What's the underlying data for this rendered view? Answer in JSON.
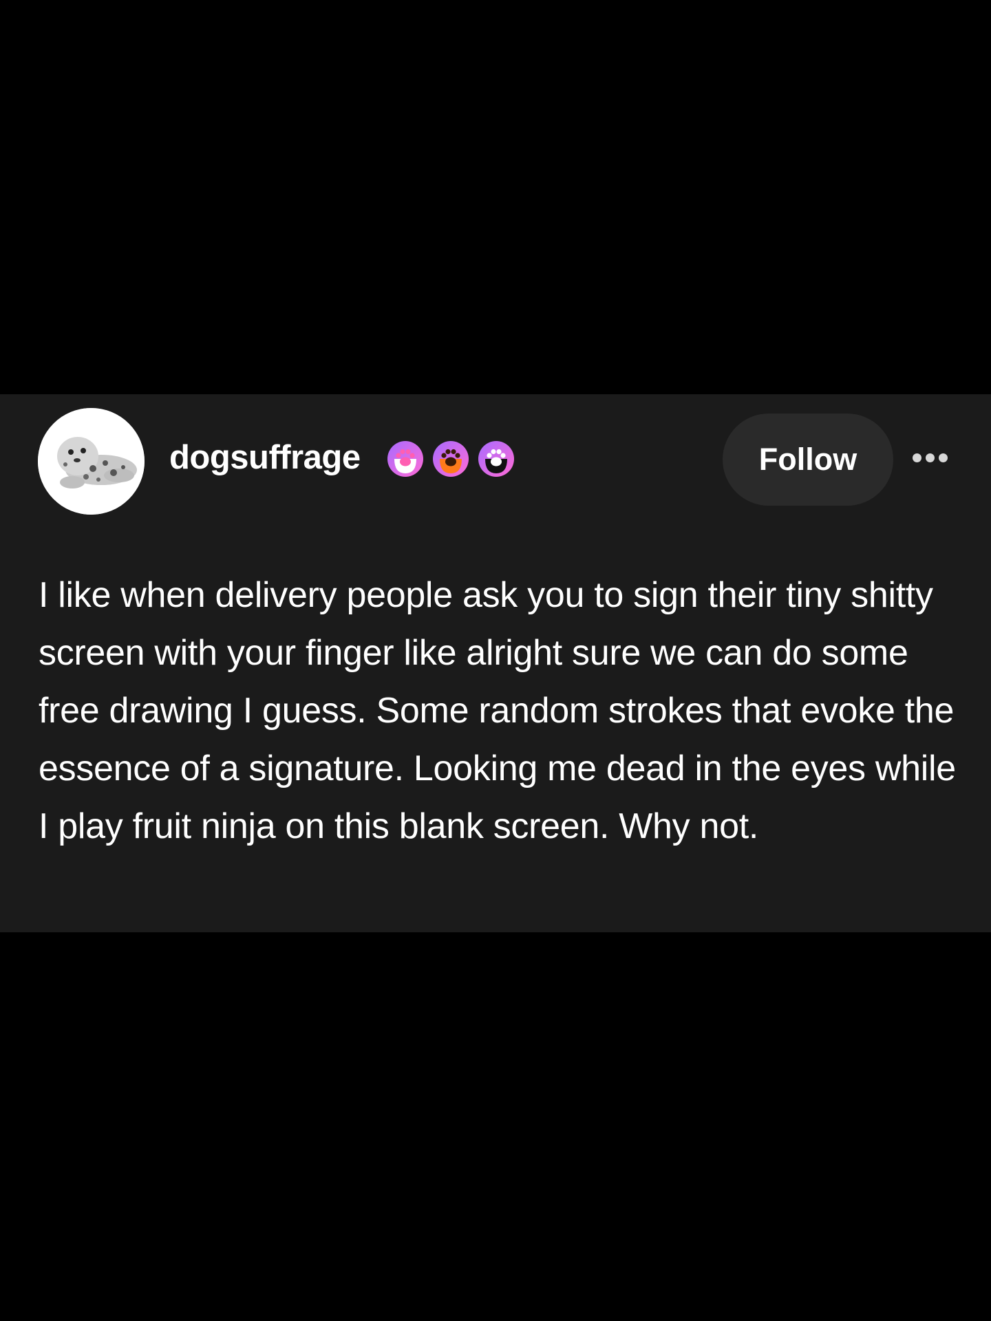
{
  "post": {
    "author": {
      "username": "dogsuffrage",
      "avatar_icon": "plush-seal-avatar",
      "badges": [
        {
          "icon": "paw-badge-icon",
          "paw_color": "#ff5fb2",
          "body_color": "#ffffff"
        },
        {
          "icon": "paw-badge-icon",
          "paw_color": "#3a1a08",
          "body_color": "#ff7a1a"
        },
        {
          "icon": "paw-badge-icon",
          "paw_color": "#ffffff",
          "body_color": "#111111"
        }
      ]
    },
    "follow_label": "Follow",
    "more_icon": "ellipsis-icon",
    "text": "I like when delivery people ask you to sign their tiny shitty screen with your finger like alright sure we can do some free drawing I guess. Some random strokes that evoke the essence of a signature. Looking me dead in the eyes while I play fruit ninja on this blank screen. Why not."
  },
  "colors": {
    "background": "#000000",
    "card": "#1b1b1b",
    "follow_button": "#2a2a2a",
    "badge_ring_start": "#a86bff",
    "badge_ring_end": "#ff6bd6"
  }
}
